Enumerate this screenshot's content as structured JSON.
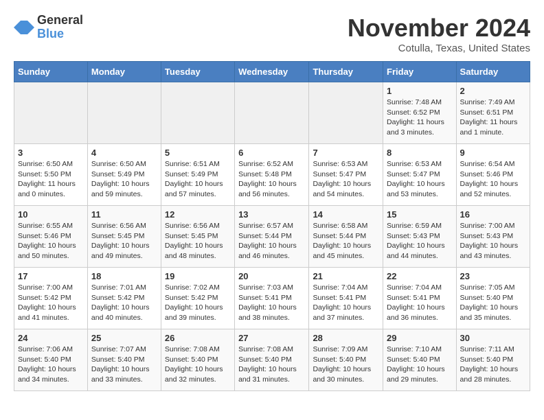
{
  "header": {
    "logo_general": "General",
    "logo_blue": "Blue",
    "month_title": "November 2024",
    "location": "Cotulla, Texas, United States"
  },
  "calendar": {
    "days_of_week": [
      "Sunday",
      "Monday",
      "Tuesday",
      "Wednesday",
      "Thursday",
      "Friday",
      "Saturday"
    ],
    "weeks": [
      [
        {
          "day": "",
          "sunrise": "",
          "sunset": "",
          "daylight": "",
          "empty": true
        },
        {
          "day": "",
          "sunrise": "",
          "sunset": "",
          "daylight": "",
          "empty": true
        },
        {
          "day": "",
          "sunrise": "",
          "sunset": "",
          "daylight": "",
          "empty": true
        },
        {
          "day": "",
          "sunrise": "",
          "sunset": "",
          "daylight": "",
          "empty": true
        },
        {
          "day": "",
          "sunrise": "",
          "sunset": "",
          "daylight": "",
          "empty": true
        },
        {
          "day": "1",
          "sunrise": "Sunrise: 7:48 AM",
          "sunset": "Sunset: 6:52 PM",
          "daylight": "Daylight: 11 hours and 3 minutes.",
          "empty": false
        },
        {
          "day": "2",
          "sunrise": "Sunrise: 7:49 AM",
          "sunset": "Sunset: 6:51 PM",
          "daylight": "Daylight: 11 hours and 1 minute.",
          "empty": false
        }
      ],
      [
        {
          "day": "3",
          "sunrise": "Sunrise: 6:50 AM",
          "sunset": "Sunset: 5:50 PM",
          "daylight": "Daylight: 11 hours and 0 minutes.",
          "empty": false
        },
        {
          "day": "4",
          "sunrise": "Sunrise: 6:50 AM",
          "sunset": "Sunset: 5:49 PM",
          "daylight": "Daylight: 10 hours and 59 minutes.",
          "empty": false
        },
        {
          "day": "5",
          "sunrise": "Sunrise: 6:51 AM",
          "sunset": "Sunset: 5:49 PM",
          "daylight": "Daylight: 10 hours and 57 minutes.",
          "empty": false
        },
        {
          "day": "6",
          "sunrise": "Sunrise: 6:52 AM",
          "sunset": "Sunset: 5:48 PM",
          "daylight": "Daylight: 10 hours and 56 minutes.",
          "empty": false
        },
        {
          "day": "7",
          "sunrise": "Sunrise: 6:53 AM",
          "sunset": "Sunset: 5:47 PM",
          "daylight": "Daylight: 10 hours and 54 minutes.",
          "empty": false
        },
        {
          "day": "8",
          "sunrise": "Sunrise: 6:53 AM",
          "sunset": "Sunset: 5:47 PM",
          "daylight": "Daylight: 10 hours and 53 minutes.",
          "empty": false
        },
        {
          "day": "9",
          "sunrise": "Sunrise: 6:54 AM",
          "sunset": "Sunset: 5:46 PM",
          "daylight": "Daylight: 10 hours and 52 minutes.",
          "empty": false
        }
      ],
      [
        {
          "day": "10",
          "sunrise": "Sunrise: 6:55 AM",
          "sunset": "Sunset: 5:46 PM",
          "daylight": "Daylight: 10 hours and 50 minutes.",
          "empty": false
        },
        {
          "day": "11",
          "sunrise": "Sunrise: 6:56 AM",
          "sunset": "Sunset: 5:45 PM",
          "daylight": "Daylight: 10 hours and 49 minutes.",
          "empty": false
        },
        {
          "day": "12",
          "sunrise": "Sunrise: 6:56 AM",
          "sunset": "Sunset: 5:45 PM",
          "daylight": "Daylight: 10 hours and 48 minutes.",
          "empty": false
        },
        {
          "day": "13",
          "sunrise": "Sunrise: 6:57 AM",
          "sunset": "Sunset: 5:44 PM",
          "daylight": "Daylight: 10 hours and 46 minutes.",
          "empty": false
        },
        {
          "day": "14",
          "sunrise": "Sunrise: 6:58 AM",
          "sunset": "Sunset: 5:44 PM",
          "daylight": "Daylight: 10 hours and 45 minutes.",
          "empty": false
        },
        {
          "day": "15",
          "sunrise": "Sunrise: 6:59 AM",
          "sunset": "Sunset: 5:43 PM",
          "daylight": "Daylight: 10 hours and 44 minutes.",
          "empty": false
        },
        {
          "day": "16",
          "sunrise": "Sunrise: 7:00 AM",
          "sunset": "Sunset: 5:43 PM",
          "daylight": "Daylight: 10 hours and 43 minutes.",
          "empty": false
        }
      ],
      [
        {
          "day": "17",
          "sunrise": "Sunrise: 7:00 AM",
          "sunset": "Sunset: 5:42 PM",
          "daylight": "Daylight: 10 hours and 41 minutes.",
          "empty": false
        },
        {
          "day": "18",
          "sunrise": "Sunrise: 7:01 AM",
          "sunset": "Sunset: 5:42 PM",
          "daylight": "Daylight: 10 hours and 40 minutes.",
          "empty": false
        },
        {
          "day": "19",
          "sunrise": "Sunrise: 7:02 AM",
          "sunset": "Sunset: 5:42 PM",
          "daylight": "Daylight: 10 hours and 39 minutes.",
          "empty": false
        },
        {
          "day": "20",
          "sunrise": "Sunrise: 7:03 AM",
          "sunset": "Sunset: 5:41 PM",
          "daylight": "Daylight: 10 hours and 38 minutes.",
          "empty": false
        },
        {
          "day": "21",
          "sunrise": "Sunrise: 7:04 AM",
          "sunset": "Sunset: 5:41 PM",
          "daylight": "Daylight: 10 hours and 37 minutes.",
          "empty": false
        },
        {
          "day": "22",
          "sunrise": "Sunrise: 7:04 AM",
          "sunset": "Sunset: 5:41 PM",
          "daylight": "Daylight: 10 hours and 36 minutes.",
          "empty": false
        },
        {
          "day": "23",
          "sunrise": "Sunrise: 7:05 AM",
          "sunset": "Sunset: 5:40 PM",
          "daylight": "Daylight: 10 hours and 35 minutes.",
          "empty": false
        }
      ],
      [
        {
          "day": "24",
          "sunrise": "Sunrise: 7:06 AM",
          "sunset": "Sunset: 5:40 PM",
          "daylight": "Daylight: 10 hours and 34 minutes.",
          "empty": false
        },
        {
          "day": "25",
          "sunrise": "Sunrise: 7:07 AM",
          "sunset": "Sunset: 5:40 PM",
          "daylight": "Daylight: 10 hours and 33 minutes.",
          "empty": false
        },
        {
          "day": "26",
          "sunrise": "Sunrise: 7:08 AM",
          "sunset": "Sunset: 5:40 PM",
          "daylight": "Daylight: 10 hours and 32 minutes.",
          "empty": false
        },
        {
          "day": "27",
          "sunrise": "Sunrise: 7:08 AM",
          "sunset": "Sunset: 5:40 PM",
          "daylight": "Daylight: 10 hours and 31 minutes.",
          "empty": false
        },
        {
          "day": "28",
          "sunrise": "Sunrise: 7:09 AM",
          "sunset": "Sunset: 5:40 PM",
          "daylight": "Daylight: 10 hours and 30 minutes.",
          "empty": false
        },
        {
          "day": "29",
          "sunrise": "Sunrise: 7:10 AM",
          "sunset": "Sunset: 5:40 PM",
          "daylight": "Daylight: 10 hours and 29 minutes.",
          "empty": false
        },
        {
          "day": "30",
          "sunrise": "Sunrise: 7:11 AM",
          "sunset": "Sunset: 5:40 PM",
          "daylight": "Daylight: 10 hours and 28 minutes.",
          "empty": false
        }
      ]
    ]
  }
}
